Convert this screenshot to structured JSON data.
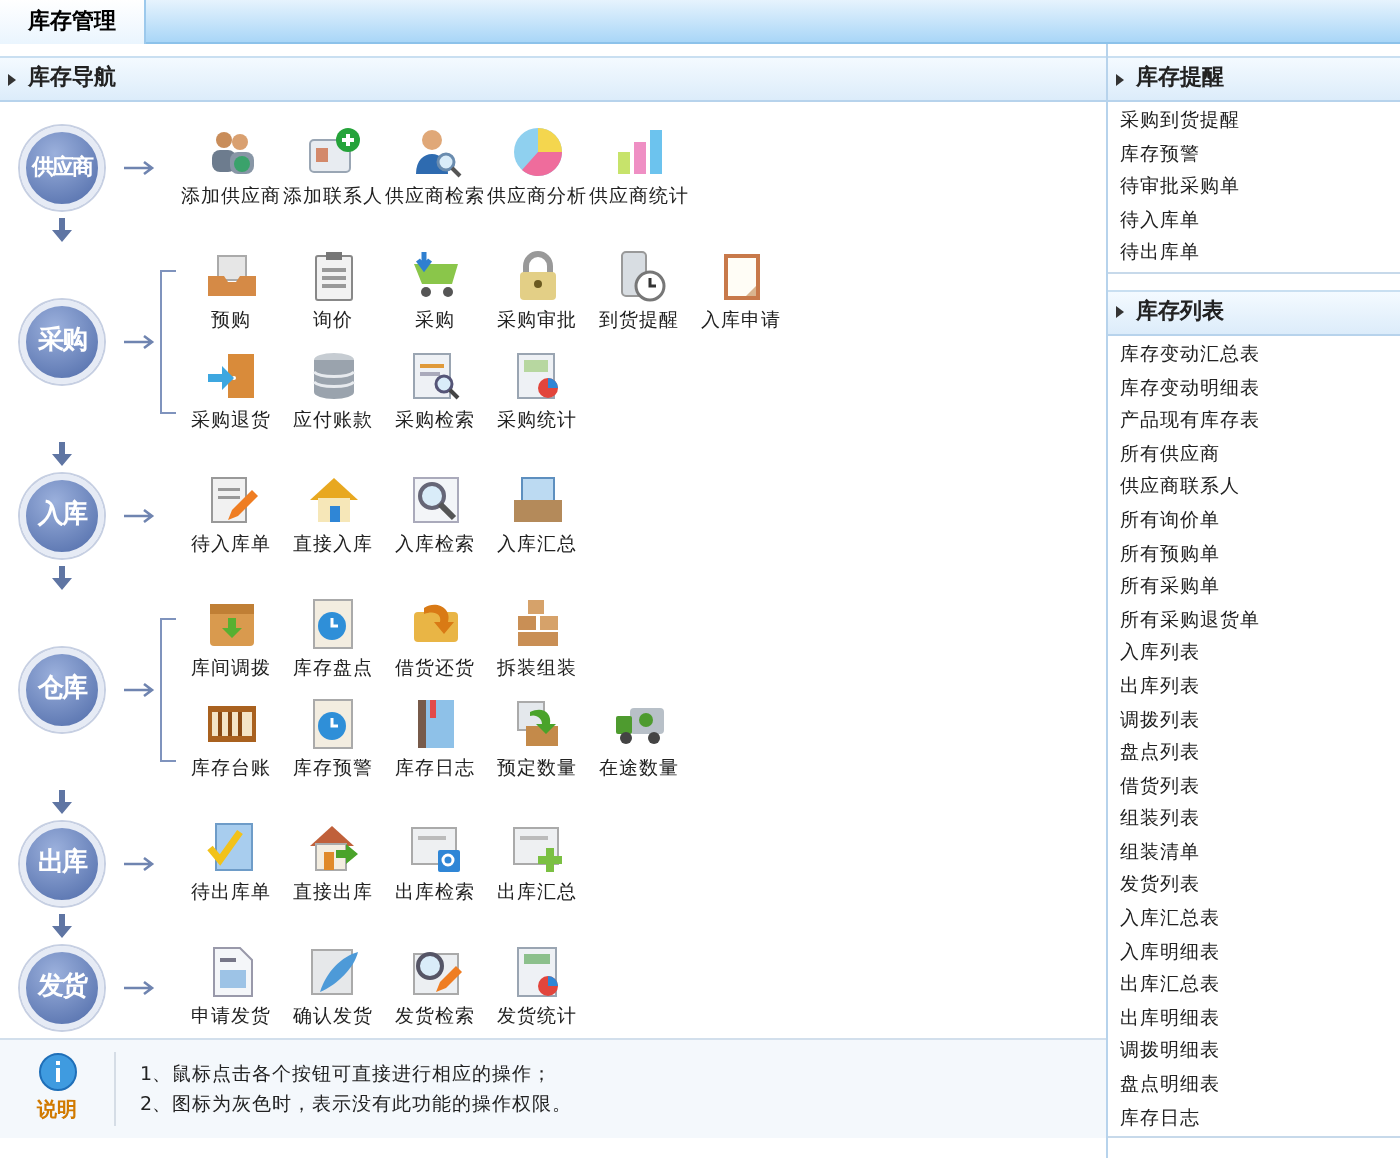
{
  "top_tab": {
    "label": "库存管理",
    "selected": true
  },
  "nav": {
    "title": "库存导航",
    "stages": [
      {
        "label": "供应商",
        "rows": [
          [
            "添加供应商",
            "添加联系人",
            "供应商检索",
            "供应商分析",
            "供应商统计"
          ]
        ]
      },
      {
        "label": "采购",
        "rows": [
          [
            "预购",
            "询价",
            "采购",
            "采购审批",
            "到货提醒",
            "入库申请"
          ],
          [
            "采购退货",
            "应付账款",
            "采购检索",
            "采购统计"
          ]
        ]
      },
      {
        "label": "入库",
        "rows": [
          [
            "待入库单",
            "直接入库",
            "入库检索",
            "入库汇总"
          ]
        ]
      },
      {
        "label": "仓库",
        "rows": [
          [
            "库间调拨",
            "库存盘点",
            "借货还货",
            "拆装组装"
          ],
          [
            "库存台账",
            "库存预警",
            "库存日志",
            "预定数量",
            "在途数量"
          ]
        ]
      },
      {
        "label": "出库",
        "rows": [
          [
            "待出库单",
            "直接出库",
            "出库检索",
            "出库汇总"
          ]
        ]
      },
      {
        "label": "发货",
        "rows": [
          [
            "申请发货",
            "确认发货",
            "发货检索",
            "发货统计"
          ]
        ]
      }
    ]
  },
  "footer": {
    "label": "说明",
    "notes": [
      "1、鼠标点击各个按钮可直接进行相应的操作；",
      "2、图标为灰色时，表示没有此功能的操作权限。"
    ]
  },
  "side_panels": [
    {
      "title": "库存提醒",
      "items": [
        "采购到货提醒",
        "库存预警",
        "待审批采购单",
        "待入库单",
        "待出库单"
      ]
    },
    {
      "title": "库存列表",
      "items": [
        "库存变动汇总表",
        "库存变动明细表",
        "产品现有库存表",
        "所有供应商",
        "供应商联系人",
        "所有询价单",
        "所有预购单",
        "所有采购单",
        "所有采购退货单",
        "入库列表",
        "出库列表",
        "调拨列表",
        "盘点列表",
        "借货列表",
        "组装列表",
        "组装清单",
        "发货列表",
        "入库汇总表",
        "入库明细表",
        "出库汇总表",
        "出库明细表",
        "调拨明细表",
        "盘点明细表",
        "库存日志"
      ]
    }
  ]
}
